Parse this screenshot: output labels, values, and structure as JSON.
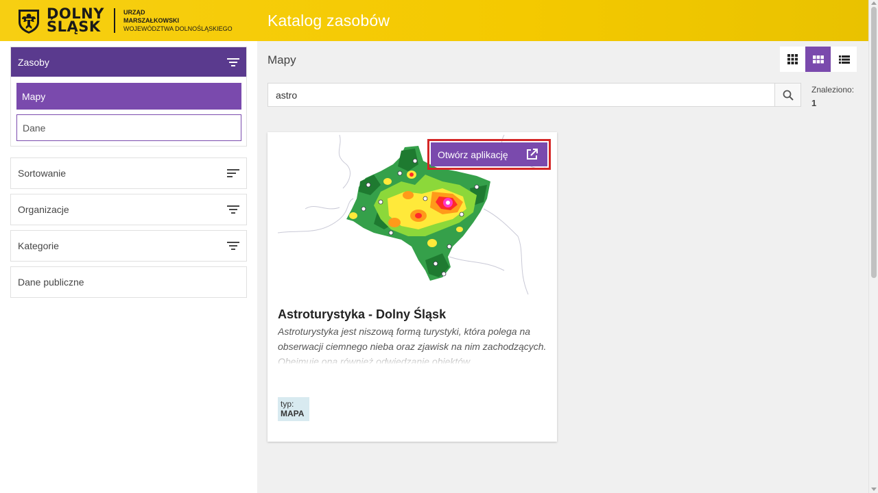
{
  "header": {
    "brand_line1": "DOLNY",
    "brand_line2": "ŚLĄSK",
    "office_line1": "URZĄD",
    "office_line2": "MARSZAŁKOWSKI",
    "office_line3": "WOJEWÓDZTWA DOLNOŚLĄSKIEGO",
    "title": "Katalog zasobów",
    "color": "#f4c900"
  },
  "sidebar": {
    "resources_label": "Zasoby",
    "types": [
      "Mapy",
      "Dane"
    ],
    "sort_label": "Sortowanie",
    "organizations_label": "Organizacje",
    "categories_label": "Kategorie",
    "public_data_label": "Dane publiczne",
    "accent": "#7a4aad"
  },
  "main": {
    "section_title": "Mapy",
    "search_value": "astro",
    "found_label": "Znaleziono:",
    "found_count": "1"
  },
  "card": {
    "title": "Astroturystyka - Dolny Śląsk",
    "description": "Astroturystyka jest niszową formą turystyki, która polega na obserwacji ciemnego nieba oraz zjawisk na nim zachodzących. Obejmuje ona również odwiedzanie obiektów",
    "open_app_label": "Otwórz aplikację",
    "type_key": "typ:",
    "type_value": "MAPA"
  }
}
